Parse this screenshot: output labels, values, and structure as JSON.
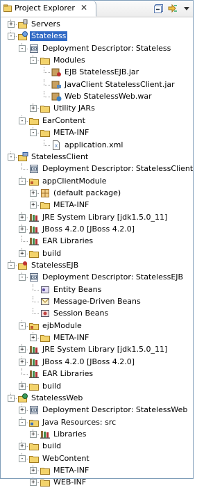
{
  "view": {
    "tab_title": "Project Explorer",
    "close_glyph": "✕"
  },
  "toolbar": {
    "collapse_all_icon": "collapse-all-icon",
    "link_with_editor_icon": "link-with-editor-icon",
    "menu_icon": "view-menu-icon"
  },
  "colors": {
    "selection": "#316ac5",
    "folder": "#f3d36b",
    "jar": "#c8a060",
    "library": "#8f6a3a"
  },
  "tree": [
    {
      "depth": 0,
      "toggle": "+",
      "icon": "servers-project",
      "label": "Servers"
    },
    {
      "depth": 0,
      "toggle": "-",
      "icon": "ear-project",
      "label": "Stateless",
      "selected": true
    },
    {
      "depth": 1,
      "toggle": "-",
      "icon": "deployment-descriptor",
      "label": "Deployment Descriptor: Stateless"
    },
    {
      "depth": 2,
      "toggle": "-",
      "icon": "folder",
      "label": "Modules"
    },
    {
      "depth": 3,
      "toggle": "",
      "icon": "ejb-jar",
      "label": "EJB StatelessEJB.jar"
    },
    {
      "depth": 3,
      "toggle": "",
      "icon": "client-jar",
      "label": "JavaClient StatelessClient.jar"
    },
    {
      "depth": 3,
      "toggle": "",
      "icon": "web-war",
      "label": "Web StatelessWeb.war"
    },
    {
      "depth": 2,
      "toggle": "+",
      "icon": "folder",
      "label": "Utility JARs"
    },
    {
      "depth": 1,
      "toggle": "-",
      "icon": "folder",
      "label": "EarContent"
    },
    {
      "depth": 2,
      "toggle": "-",
      "icon": "folder",
      "label": "META-INF"
    },
    {
      "depth": 3,
      "toggle": "",
      "icon": "xml-file",
      "label": "application.xml"
    },
    {
      "depth": 0,
      "toggle": "-",
      "icon": "client-project",
      "label": "StatelessClient"
    },
    {
      "depth": 1,
      "toggle": "",
      "icon": "deployment-descriptor",
      "label": "Deployment Descriptor: StatelessClient"
    },
    {
      "depth": 1,
      "toggle": "-",
      "icon": "source-folder",
      "label": "appClientModule"
    },
    {
      "depth": 2,
      "toggle": "+",
      "icon": "package",
      "label": "(default package)"
    },
    {
      "depth": 2,
      "toggle": "+",
      "icon": "folder",
      "label": "META-INF"
    },
    {
      "depth": 1,
      "toggle": "+",
      "icon": "library",
      "label": "JRE System Library [jdk1.5.0_11]"
    },
    {
      "depth": 1,
      "toggle": "+",
      "icon": "library",
      "label": "JBoss 4.2.0 [JBoss 4.2.0]"
    },
    {
      "depth": 1,
      "toggle": "",
      "icon": "library",
      "label": "EAR Libraries"
    },
    {
      "depth": 1,
      "toggle": "+",
      "icon": "folder",
      "label": "build"
    },
    {
      "depth": 0,
      "toggle": "-",
      "icon": "ejb-project",
      "label": "StatelessEJB"
    },
    {
      "depth": 1,
      "toggle": "-",
      "icon": "deployment-descriptor",
      "label": "Deployment Descriptor: StatelessEJB"
    },
    {
      "depth": 2,
      "toggle": "",
      "icon": "entity-beans",
      "label": "Entity Beans"
    },
    {
      "depth": 2,
      "toggle": "",
      "icon": "message-beans",
      "label": "Message-Driven Beans"
    },
    {
      "depth": 2,
      "toggle": "",
      "icon": "session-beans",
      "label": "Session Beans"
    },
    {
      "depth": 1,
      "toggle": "-",
      "icon": "source-folder",
      "label": "ejbModule"
    },
    {
      "depth": 2,
      "toggle": "+",
      "icon": "folder",
      "label": "META-INF"
    },
    {
      "depth": 1,
      "toggle": "+",
      "icon": "library",
      "label": "JRE System Library [jdk1.5.0_11]"
    },
    {
      "depth": 1,
      "toggle": "+",
      "icon": "library",
      "label": "JBoss 4.2.0 [JBoss 4.2.0]"
    },
    {
      "depth": 1,
      "toggle": "",
      "icon": "library",
      "label": "EAR Libraries"
    },
    {
      "depth": 1,
      "toggle": "+",
      "icon": "folder",
      "label": "build"
    },
    {
      "depth": 0,
      "toggle": "-",
      "icon": "web-project",
      "label": "StatelessWeb"
    },
    {
      "depth": 1,
      "toggle": "+",
      "icon": "deployment-descriptor",
      "label": "Deployment Descriptor: StatelessWeb"
    },
    {
      "depth": 1,
      "toggle": "-",
      "icon": "java-resources",
      "label": "Java Resources: src"
    },
    {
      "depth": 2,
      "toggle": "+",
      "icon": "library",
      "label": "Libraries"
    },
    {
      "depth": 1,
      "toggle": "+",
      "icon": "folder",
      "label": "build"
    },
    {
      "depth": 1,
      "toggle": "-",
      "icon": "folder",
      "label": "WebContent"
    },
    {
      "depth": 2,
      "toggle": "+",
      "icon": "folder",
      "label": "META-INF"
    },
    {
      "depth": 2,
      "toggle": "+",
      "icon": "folder",
      "label": "WEB-INF"
    }
  ]
}
